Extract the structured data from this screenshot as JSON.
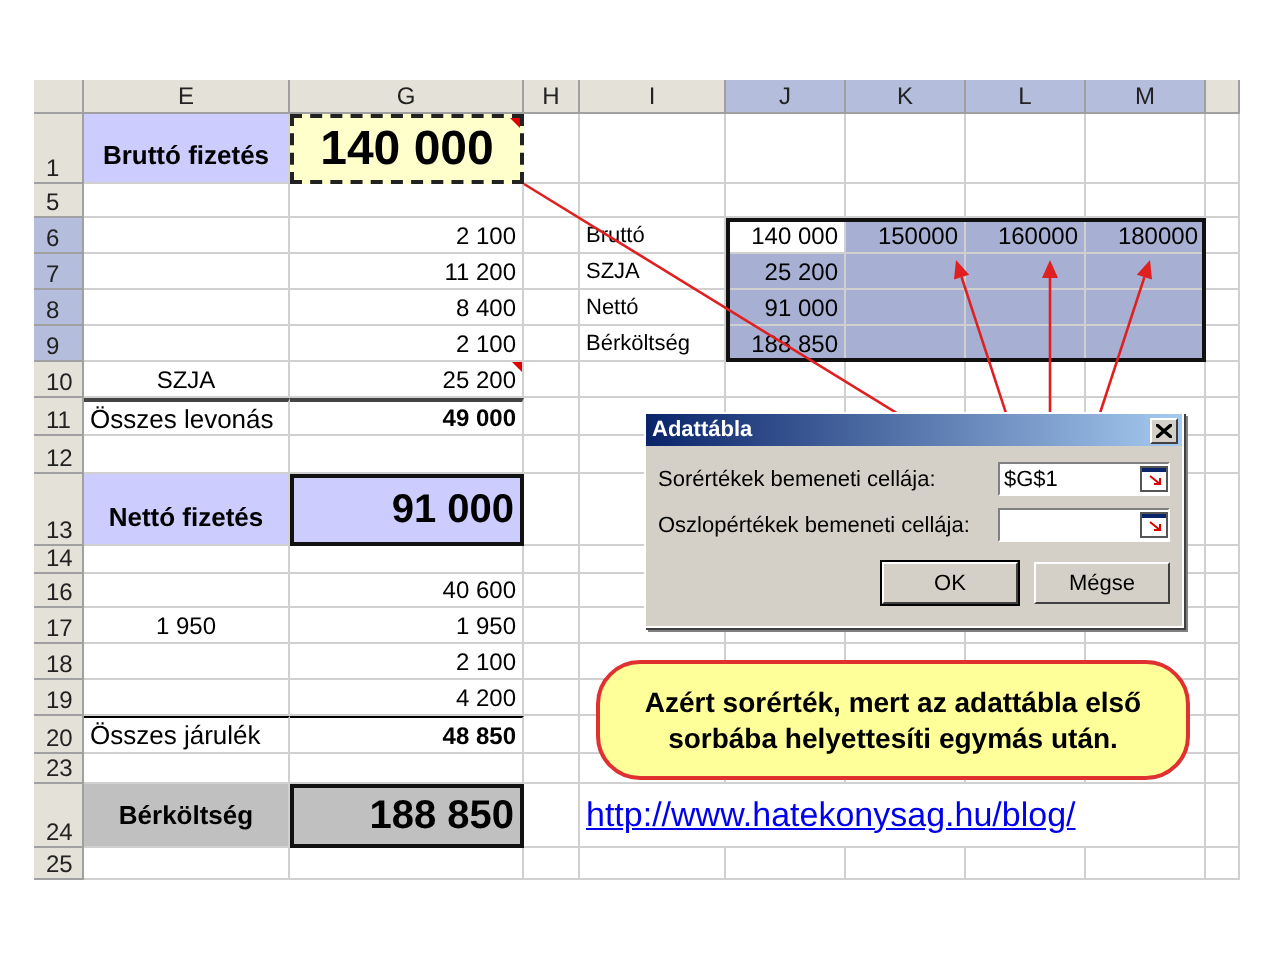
{
  "columns": [
    {
      "label": "E",
      "selected": false
    },
    {
      "label": "G",
      "selected": false
    },
    {
      "label": "H",
      "selected": false
    },
    {
      "label": "I",
      "selected": false
    },
    {
      "label": "J",
      "selected": true
    },
    {
      "label": "K",
      "selected": true
    },
    {
      "label": "L",
      "selected": true
    },
    {
      "label": "M",
      "selected": true
    }
  ],
  "rows": [
    {
      "number": "1",
      "selected": false,
      "cells": {
        "e": {
          "text": "Bruttó fizetés",
          "kind": "title_label"
        },
        "g": {
          "text": "140 000",
          "kind": "input_value",
          "comment": true
        }
      }
    },
    {
      "number": "5",
      "selected": false,
      "cells": {}
    },
    {
      "number": "6",
      "selected": true,
      "cells": {
        "g": {
          "text": "2 100",
          "kind": "number"
        },
        "i": {
          "text": "Bruttó",
          "kind": "label"
        },
        "j": {
          "text": "140 000",
          "kind": "number",
          "selected": true,
          "active": true
        },
        "k": {
          "text": "150000",
          "kind": "number",
          "selected": true
        },
        "l": {
          "text": "160000",
          "kind": "number",
          "selected": true
        },
        "m": {
          "text": "180000",
          "kind": "number",
          "selected": true
        }
      }
    },
    {
      "number": "7",
      "selected": true,
      "cells": {
        "g": {
          "text": "11 200",
          "kind": "number"
        },
        "i": {
          "text": "SZJA",
          "kind": "label"
        },
        "j": {
          "text": "25 200",
          "kind": "number",
          "selected": true
        },
        "k": {
          "selected": true
        },
        "l": {
          "selected": true
        },
        "m": {
          "selected": true
        }
      }
    },
    {
      "number": "8",
      "selected": true,
      "cells": {
        "g": {
          "text": "8 400",
          "kind": "number"
        },
        "i": {
          "text": "Nettó",
          "kind": "label"
        },
        "j": {
          "text": "91 000",
          "kind": "number",
          "selected": true
        },
        "k": {
          "selected": true
        },
        "l": {
          "selected": true
        },
        "m": {
          "selected": true
        }
      }
    },
    {
      "number": "9",
      "selected": true,
      "cells": {
        "g": {
          "text": "2 100",
          "kind": "number"
        },
        "i": {
          "text": "Bérköltség",
          "kind": "label"
        },
        "j": {
          "text": "188 850",
          "kind": "number",
          "selected": true
        },
        "k": {
          "selected": true
        },
        "l": {
          "selected": true
        },
        "m": {
          "selected": true
        }
      }
    },
    {
      "number": "10",
      "selected": false,
      "cells": {
        "e": {
          "text": "SZJA",
          "kind": "center"
        },
        "g": {
          "text": "25 200",
          "kind": "number",
          "comment": true
        }
      }
    },
    {
      "number": "11",
      "selected": false,
      "cells": {
        "e": {
          "text": "Összes levonás",
          "kind": "total_label"
        },
        "g": {
          "text": "49 000",
          "kind": "total_value"
        }
      }
    },
    {
      "number": "12",
      "selected": false,
      "cells": {}
    },
    {
      "number": "13",
      "selected": false,
      "cells": {
        "e": {
          "text": "Nettó fizetés",
          "kind": "title_label"
        },
        "g": {
          "text": "91 000",
          "kind": "result_value"
        }
      }
    },
    {
      "number": "14",
      "selected": false,
      "cells": {}
    },
    {
      "number": "16",
      "selected": false,
      "cells": {
        "g": {
          "text": "40 600",
          "kind": "number"
        }
      }
    },
    {
      "number": "17",
      "selected": false,
      "cells": {
        "e": {
          "text": "1 950",
          "kind": "center"
        },
        "g": {
          "text": "1 950",
          "kind": "number"
        }
      }
    },
    {
      "number": "18",
      "selected": false,
      "cells": {
        "g": {
          "text": "2 100",
          "kind": "number"
        }
      }
    },
    {
      "number": "19",
      "selected": false,
      "cells": {
        "g": {
          "text": "4 200",
          "kind": "number"
        }
      }
    },
    {
      "number": "20",
      "selected": false,
      "cells": {
        "e": {
          "text": "Összes járulék",
          "kind": "total_label_thin"
        },
        "g": {
          "text": "48 850",
          "kind": "total_value_thin"
        }
      }
    },
    {
      "number": "23",
      "selected": false,
      "cells": {}
    },
    {
      "number": "24",
      "selected": false,
      "cells": {
        "e": {
          "text": "Bérköltség",
          "kind": "cost_label"
        },
        "g": {
          "text": "188 850",
          "kind": "cost_value"
        },
        "i": {
          "text": "http://www.hatekonysag.hu/blog/",
          "kind": "link"
        }
      }
    },
    {
      "number": "25",
      "selected": false,
      "cells": {}
    }
  ],
  "dialog": {
    "title": "Adattábla",
    "fields": [
      {
        "label": "Sorértékek bemeneti cellája:",
        "value": "$G$1"
      },
      {
        "label": "Oszlopértékek bemeneti cellája:"
      }
    ],
    "buttons": [
      "OK",
      "Mégse"
    ]
  },
  "callout": {
    "text": "Azért sorérték, mert az adattábla első sorbába helyettesíti egymás után."
  }
}
